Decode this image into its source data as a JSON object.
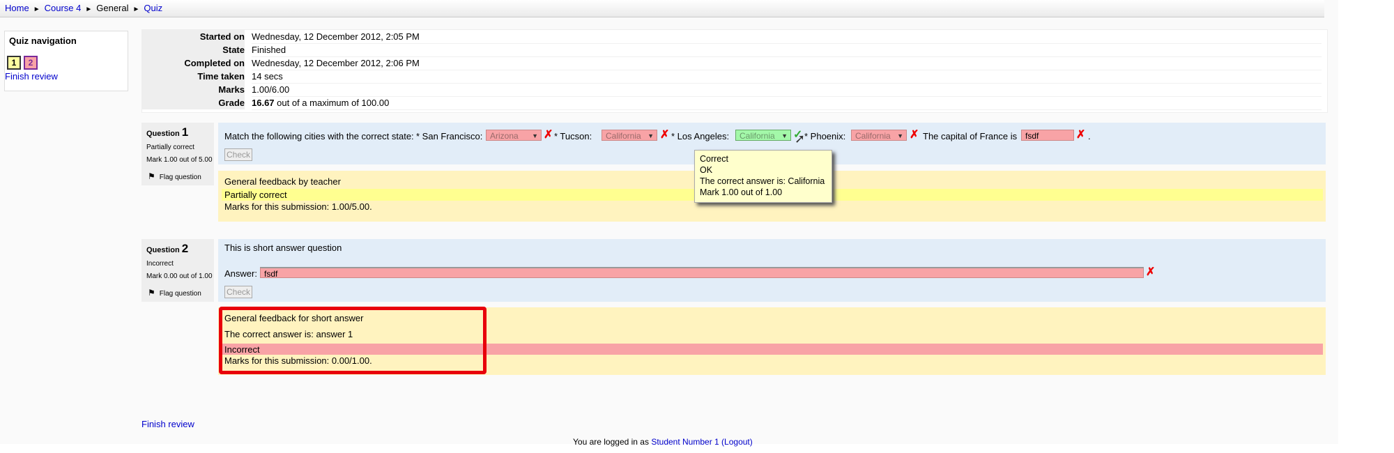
{
  "breadcrumb": {
    "items": [
      "Home",
      "Course 4",
      "General",
      "Quiz"
    ],
    "separator": "►"
  },
  "nav_block": {
    "title": "Quiz navigation",
    "buttons": [
      "1",
      "2"
    ],
    "finish_link": "Finish review"
  },
  "summary": {
    "rows": [
      {
        "label": "Started on",
        "value": "Wednesday, 12 December 2012, 2:05 PM"
      },
      {
        "label": "State",
        "value": "Finished"
      },
      {
        "label": "Completed on",
        "value": "Wednesday, 12 December 2012, 2:06 PM"
      },
      {
        "label": "Time taken",
        "value": "14 secs"
      },
      {
        "label": "Marks",
        "value": "1.00/6.00"
      },
      {
        "label": "Grade",
        "value_bold": "16.67",
        "value_rest": " out of a maximum of 100.00"
      }
    ]
  },
  "q1": {
    "label": "Question ",
    "number": "1",
    "state": "Partially correct",
    "mark": "Mark 1.00 out of 5.00",
    "flag": "Flag question",
    "intro": "Match the following cities with the correct state:",
    "city1": "* San Francisco:",
    "sel1": "Arizona",
    "city2": "* Tucson:",
    "sel2": "California",
    "city3": "* Los Angeles:",
    "sel3": "California",
    "city4": "* Phoenix:",
    "sel4": "California",
    "capital": "The capital of France is",
    "answer": "fsdf",
    "period": ".",
    "check": "Check",
    "general_feedback": "General feedback by teacher",
    "outcome": "Partially correct",
    "marks_submission": "Marks for this submission: 1.00/5.00."
  },
  "tooltip": {
    "line1": "Correct",
    "line2": "OK",
    "line3": "The correct answer is: California",
    "line4": "Mark 1.00 out of 1.00"
  },
  "q2": {
    "label": "Question ",
    "number": "2",
    "state": "Incorrect",
    "mark": "Mark 0.00 out of 1.00",
    "flag": "Flag question",
    "text": "This is short answer question",
    "answer_label": "Answer:",
    "answer": "fsdf",
    "check": "Check",
    "general_feedback": "General feedback for short answer",
    "right_answer": "The correct answer is: answer 1",
    "outcome": "Incorrect",
    "marks_submission": "Marks for this submission: 0.00/1.00."
  },
  "footer": {
    "finish_link": "Finish review",
    "logged_in": "You are logged in as ",
    "user": "Student Number 1",
    "logout": "(Logout)"
  },
  "colors": {
    "highlight_box": "#e8000b",
    "link": "#0000cc",
    "info_bg": "#e2edf8",
    "feedback_bg": "#fff3bf"
  }
}
